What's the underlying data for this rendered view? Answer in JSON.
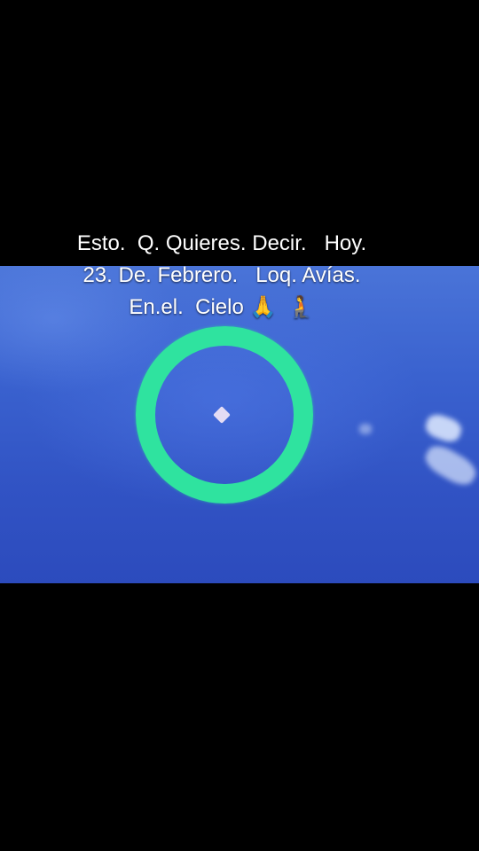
{
  "video": {
    "caption_lines": [
      "Esto.  Q. Quieres. Decir.   Hoy.",
      "23. De. Febrero.   Loq. Avías.",
      "En.el.  Cielo 🙏  🧎"
    ]
  },
  "colors": {
    "ring": "#2fe39f",
    "sky": "#3a62cf",
    "letterbox": "#000000"
  }
}
